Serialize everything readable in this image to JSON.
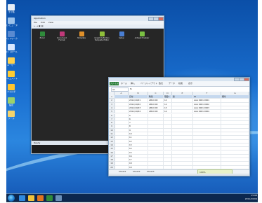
{
  "colors": {
    "desktop": "#1a6fd0",
    "taskbar": "#0a1e3c",
    "excel_accent": "#2a7d39",
    "app_dark_bg": "#262626"
  },
  "desktop_icons": [
    {
      "label": "ゴミ箱",
      "icon": "recycle-bin-icon",
      "color": "#e8eef5"
    },
    {
      "label": "コンピュータ",
      "icon": "computer-icon",
      "color": "#9cc2ea"
    },
    {
      "label": "ネットワーク",
      "icon": "network-icon",
      "color": "#5a8ad0"
    },
    {
      "label": "コントロール",
      "icon": "control-panel-icon",
      "color": "#d7e7ff"
    },
    {
      "label": "ユーザー",
      "icon": "user-folder-icon",
      "color": "#ffd34d"
    },
    {
      "label": "ドキュメント",
      "icon": "documents-folder-icon",
      "color": "#ffcc33"
    },
    {
      "label": "フォルダ",
      "icon": "folder-icon",
      "color": "#ffc52e"
    },
    {
      "label": "設定",
      "icon": "settings-icon",
      "color": "#9bd16a"
    },
    {
      "label": "ツール",
      "icon": "tool-icon",
      "color": "#f5d36b"
    }
  ],
  "app_window": {
    "title": "Application",
    "menu": [
      "File",
      "Edit",
      "View"
    ],
    "toolbar": "← → ▣ ▤",
    "status": "Ready",
    "icons": [
      {
        "label": "Excel",
        "icon": "excel-icon",
        "color": "#2f8b3b"
      },
      {
        "label": "Document Format",
        "icon": "document-icon",
        "color": "#c0397a"
      },
      {
        "label": "Template",
        "icon": "template-icon",
        "color": "#e0902a"
      },
      {
        "label": "Graph Definition\nTemplate Editor",
        "icon": "graph-editor-icon",
        "color": "#8fbf3a"
      },
      {
        "label": "Setup",
        "icon": "setup-icon",
        "color": "#4a7fd4"
      },
      {
        "label": "ActiveX Enabler",
        "icon": "activex-icon",
        "color": "#7ac043"
      }
    ]
  },
  "excel": {
    "tabs": [
      "ファイル",
      "ホーム",
      "挿入",
      "ページレイアウト",
      "数式",
      "データ",
      "校閲",
      "表示"
    ],
    "cell_ref": "A1",
    "formula": "fx",
    "columns": [
      "A",
      "B",
      "C",
      "D",
      "E",
      "F",
      "G"
    ],
    "rows": [
      {
        "n": "1",
        "cells": [
          "",
          "日付",
          "時刻",
          "項目1",
          "値",
          "ID",
          "備考"
        ],
        "header": true
      },
      {
        "n": "2",
        "cells": [
          "",
          "2011/10/01",
          "AM10:00",
          "12",
          "",
          "AAA 0001 0001",
          ""
        ]
      },
      {
        "n": "3",
        "cells": [
          "",
          "2011/10/02",
          "AM10:00",
          "12",
          "",
          "AAA 0001 0002",
          ""
        ]
      },
      {
        "n": "4",
        "cells": [
          "",
          "2011/10/03",
          "AM10:00",
          "13",
          "",
          "AAA 0001 0003",
          ""
        ]
      },
      {
        "n": "5",
        "cells": [
          "",
          "2011/10/04",
          "AM10:00",
          "14",
          "",
          "AAA 0001 0004",
          ""
        ]
      },
      {
        "n": "6",
        "cells": [
          "",
          "5",
          "",
          "",
          "",
          "",
          ""
        ]
      },
      {
        "n": "7",
        "cells": [
          "",
          "6",
          "",
          "",
          "",
          "",
          ""
        ]
      },
      {
        "n": "8",
        "cells": [
          "",
          "7",
          "",
          "",
          "",
          "",
          ""
        ]
      },
      {
        "n": "9",
        "cells": [
          "",
          "8",
          "",
          "",
          "",
          "",
          ""
        ]
      },
      {
        "n": "10",
        "cells": [
          "",
          "9",
          "",
          "",
          "",
          "",
          ""
        ]
      },
      {
        "n": "11",
        "cells": [
          "",
          "10",
          "",
          "",
          "",
          "",
          ""
        ]
      },
      {
        "n": "12",
        "cells": [
          "",
          "11",
          "",
          "",
          "",
          "",
          ""
        ]
      },
      {
        "n": "13",
        "cells": [
          "",
          "12",
          "",
          "",
          "",
          "",
          ""
        ]
      },
      {
        "n": "14",
        "cells": [
          "",
          "13",
          "",
          "",
          "",
          "",
          ""
        ]
      },
      {
        "n": "15",
        "cells": [
          "",
          "14",
          "",
          "",
          "",
          "",
          ""
        ]
      },
      {
        "n": "16",
        "cells": [
          "",
          "15",
          "",
          "",
          "",
          "",
          ""
        ]
      },
      {
        "n": "17",
        "cells": [
          "",
          "16",
          "",
          "",
          "",
          "",
          ""
        ]
      },
      {
        "n": "18",
        "cells": [
          "",
          "17",
          "",
          "",
          "",
          "",
          ""
        ]
      },
      {
        "n": "19",
        "cells": [
          "",
          "18",
          "",
          "",
          "",
          "",
          ""
        ]
      },
      {
        "n": "20",
        "cells": [
          "",
          "19",
          "",
          "",
          "",
          "",
          ""
        ]
      }
    ],
    "sheets": [
      "Sheet1",
      "Sheet2",
      "Sheet3"
    ],
    "zoom": "100%"
  },
  "taskbar": {
    "apps": [
      {
        "icon": "ie-icon",
        "color": "#2f89e0"
      },
      {
        "icon": "explorer-icon",
        "color": "#f0c23a"
      },
      {
        "icon": "media-player-icon",
        "color": "#e0741f"
      },
      {
        "icon": "excel-taskbar-icon",
        "color": "#2f8b3b"
      },
      {
        "icon": "app-taskbar-icon",
        "color": "#6a8fb8"
      }
    ],
    "time": "15:08",
    "date": "2011/10/04"
  }
}
